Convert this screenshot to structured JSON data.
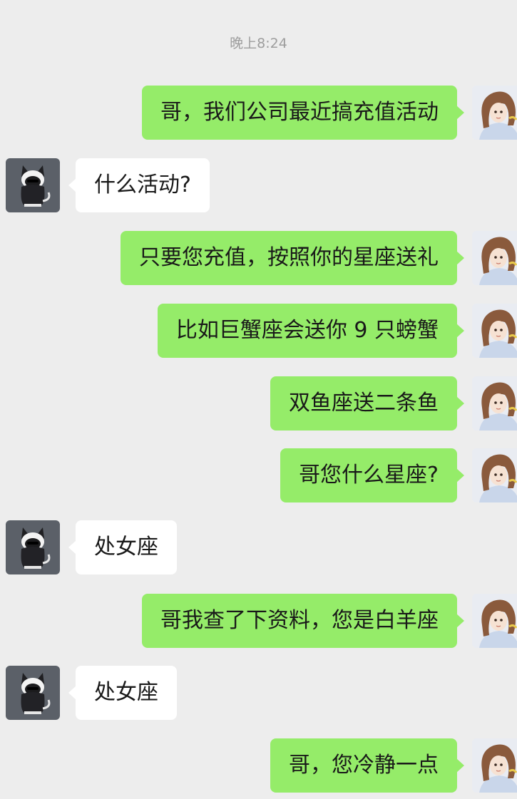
{
  "timestamp": "晚上8:24",
  "colors": {
    "outgoing_bubble": "#95ec69",
    "incoming_bubble": "#ffffff",
    "background": "#ededed"
  },
  "contacts": {
    "me_avatar": "anime-girl-avatar",
    "other_avatar": "black-cat-hoodie-avatar"
  },
  "messages": [
    {
      "side": "right",
      "text": "哥，我们公司最近搞充值活动"
    },
    {
      "side": "left",
      "text": "什么活动?"
    },
    {
      "side": "right",
      "text": "只要您充值，按照你的星座送礼"
    },
    {
      "side": "right",
      "text": "比如巨蟹座会送你 9 只螃蟹"
    },
    {
      "side": "right",
      "text": "双鱼座送二条鱼"
    },
    {
      "side": "right",
      "text": "哥您什么星座?"
    },
    {
      "side": "left",
      "text": "处女座"
    },
    {
      "side": "right",
      "text": "哥我查了下资料，您是白羊座"
    },
    {
      "side": "left",
      "text": "处女座"
    },
    {
      "side": "right",
      "text": "哥，您冷静一点"
    }
  ]
}
